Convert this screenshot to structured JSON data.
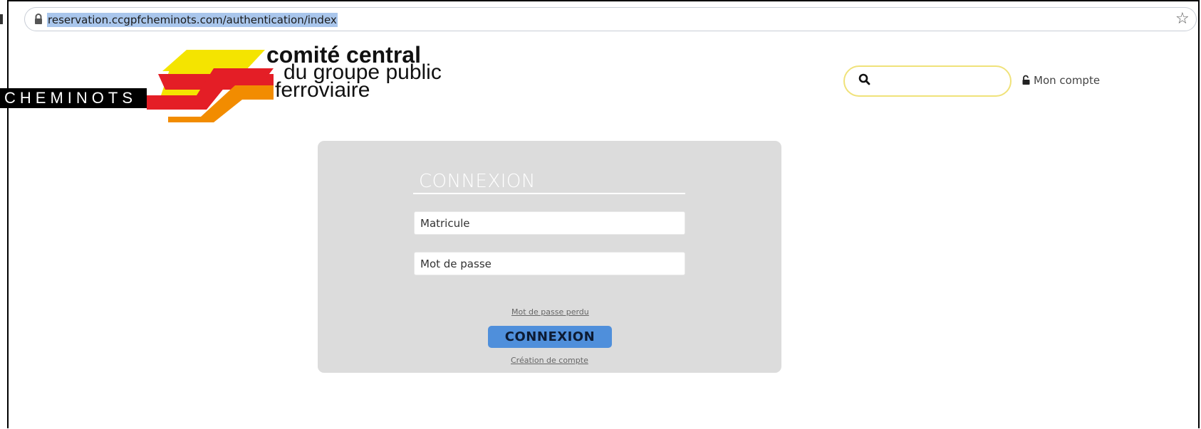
{
  "browser": {
    "url": "reservation.ccgpfcheminots.com/authentication/index",
    "icons": [
      "lock-icon",
      "star-icon"
    ]
  },
  "logo": {
    "line1": "comité central",
    "line2": "du groupe public",
    "line3": "ferroviaire",
    "side_text": "CHEMINOTS",
    "colors": {
      "yellow": "#f4e400",
      "red": "#e41e26",
      "orange": "#f28c00"
    }
  },
  "header": {
    "search_icon": "search-icon",
    "account_label": "Mon compte",
    "account_icon": "unlock-icon"
  },
  "login": {
    "title": "CONNEXION",
    "matricule_placeholder": "Matricule",
    "password_placeholder": "Mot de passe",
    "lost_password": "Mot de passe perdu",
    "submit_label": "CONNEXION",
    "create_account": "Création de compte",
    "button_color": "#4f8fdb",
    "panel_color": "#dcdcdc"
  }
}
